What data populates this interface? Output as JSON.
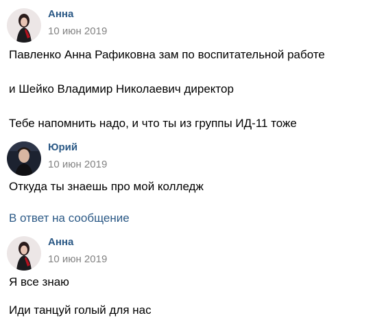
{
  "messages": [
    {
      "author": "Анна",
      "date": "10 июн 2019",
      "lines": [
        "Павленко Анна Рафиковна зам по воспитательной работе",
        "и Шейко Владимир Николаевич директор",
        "Тебе напомнить надо, и что ты из группы ИД-11 тоже"
      ]
    },
    {
      "author": "Юрий",
      "date": "10 июн 2019",
      "lines": [
        "Откуда ты знаешь про мой колледж"
      ],
      "reply_link": "В ответ на сообщение"
    },
    {
      "author": "Анна",
      "date": "10 июн 2019",
      "lines": [
        "Я все знаю",
        "Иди танцуй голый для нас"
      ]
    }
  ],
  "colors": {
    "author": "#2a5885",
    "date": "#828282",
    "text": "#000000",
    "link": "#2a5885"
  },
  "icons": {
    "anna_avatar": "avatar-photo-anna",
    "yuri_avatar": "avatar-photo-yuri"
  }
}
